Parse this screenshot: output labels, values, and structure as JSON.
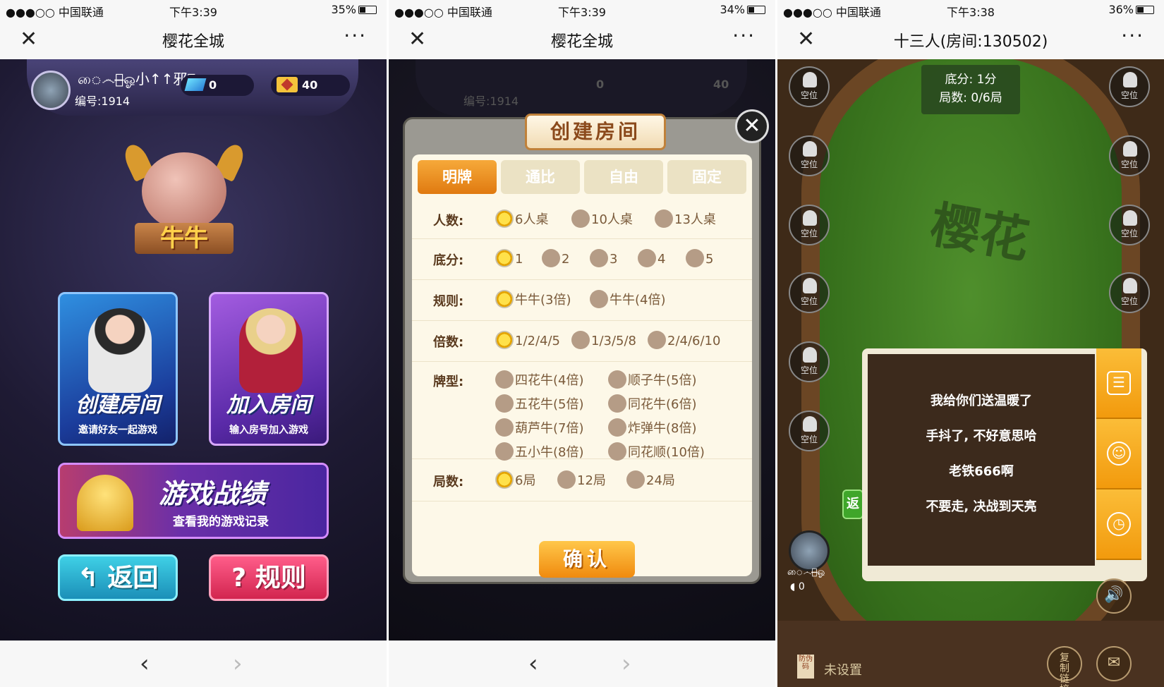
{
  "panels": [
    {
      "status": {
        "carrier": "●●●○○ 中国联通",
        "wifi": "wifi-icon",
        "time": "下午3:39",
        "battery": "35%",
        "battery_level": 0.35
      },
      "nav": {
        "title": "樱花全城",
        "close": "✕",
        "more": "···"
      },
      "user": {
        "name": "ை෴ฏ̶̶ஓ小↑↑邪ฏ̶̶ஓ෴ை",
        "id_label": "编号:1914",
        "diamonds": "0",
        "tickets": "40"
      },
      "logo_text": "牛牛",
      "create_room": {
        "title": "创建房间",
        "subtitle": "邀请好友一起游戏"
      },
      "join_room": {
        "title": "加入房间",
        "subtitle": "输入房号加入游戏"
      },
      "records": {
        "title": "游戏战绩",
        "subtitle": "查看我的游戏记录"
      },
      "back_button": "↰ 返回",
      "rules_button": "? 规则",
      "bottom": {
        "back": "‹",
        "forward": "›"
      }
    },
    {
      "status": {
        "carrier": "●●●○○ 中国联通",
        "wifi": "wifi-icon",
        "time": "下午3:39",
        "battery": "34%",
        "battery_level": 0.34
      },
      "nav": {
        "title": "樱花全城",
        "close": "✕",
        "more": "···"
      },
      "dialog": {
        "title": "创建房间",
        "close": "✕",
        "tabs": [
          "明牌",
          "通比",
          "自由",
          "固定"
        ],
        "active_tab": 0,
        "players": {
          "label": "人数:",
          "options": [
            "6人桌",
            "10人桌",
            "13人桌"
          ],
          "selected": 0
        },
        "base": {
          "label": "底分:",
          "options": [
            "1",
            "2",
            "3",
            "4",
            "5"
          ],
          "selected": 0
        },
        "rules": {
          "label": "规则:",
          "options": [
            "牛牛(3倍)",
            "牛牛(4倍)"
          ],
          "selected": 0
        },
        "multiplier": {
          "label": "倍数:",
          "options": [
            "1/2/4/5",
            "1/3/5/8",
            "2/4/6/10"
          ],
          "selected": 0
        },
        "hand_types": {
          "label": "牌型:",
          "options": [
            "四花牛(4倍)",
            "顺子牛(5倍)",
            "五花牛(5倍)",
            "同花牛(6倍)",
            "葫芦牛(7倍)",
            "炸弹牛(8倍)",
            "五小牛(8倍)",
            "同花顺(10倍)"
          ]
        },
        "rounds": {
          "label": "局数:",
          "options": [
            "6局",
            "12局",
            "24局"
          ],
          "selected": 0
        },
        "confirm": "确认"
      },
      "behind": {
        "id_label": "编号:1914",
        "diamonds": "0",
        "tickets": "40"
      },
      "bottom": {
        "back": "‹",
        "forward": "›"
      }
    },
    {
      "status": {
        "carrier": "●●●○○ 中国联通",
        "wifi": "wifi-icon",
        "time": "下午3:38",
        "battery": "36%",
        "battery_level": 0.36
      },
      "nav": {
        "title": "十三人(房间:130502)",
        "close": "✕",
        "more": "···"
      },
      "table": {
        "base_score": "底分: 1分",
        "rounds": "局数: 0/6局",
        "seat_label": "空位",
        "watermark": "樱花",
        "return_stub": "返"
      },
      "chat": {
        "messages": [
          "我给你们送温暖了",
          "手抖了, 不好意思哈",
          "老铁666啊",
          "不要走, 决战到天亮"
        ]
      },
      "player": {
        "name": "ை෴ฏ̶̶ஓ",
        "coins": "0"
      },
      "footer": {
        "anti_fake": "防伪码",
        "unset": "未设置",
        "copy_link": "复制链接"
      }
    }
  ]
}
